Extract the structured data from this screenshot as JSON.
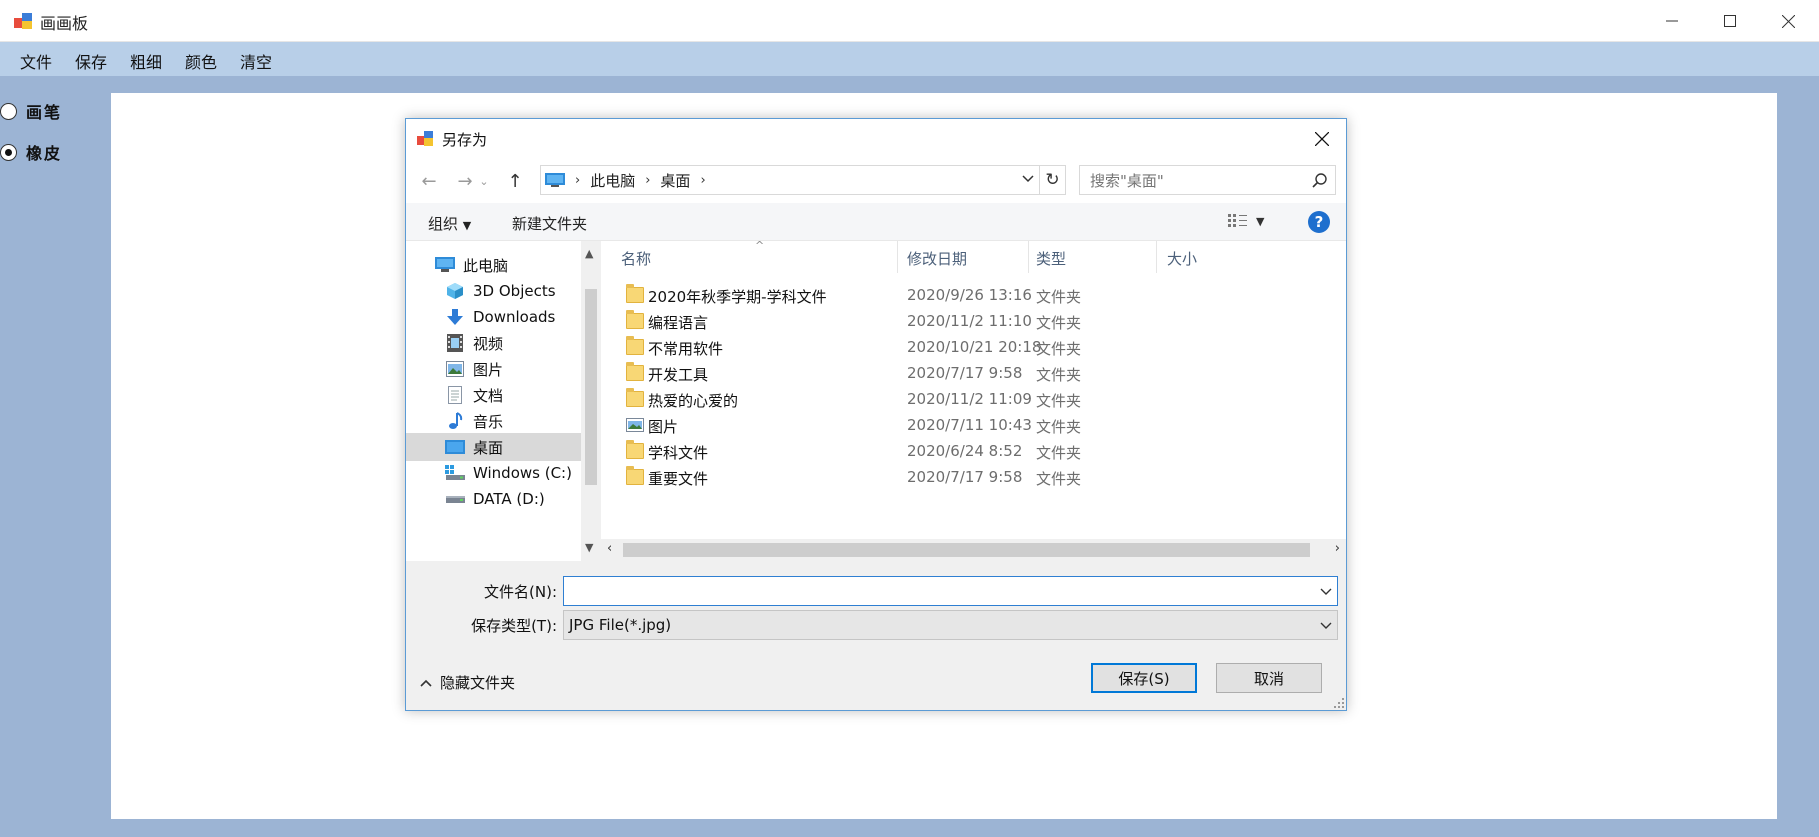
{
  "app": {
    "title": "画画板",
    "menu": [
      "文件",
      "保存",
      "粗细",
      "颜色",
      "清空"
    ],
    "tools": [
      {
        "label": "画笔",
        "checked": false
      },
      {
        "label": "橡皮",
        "checked": true
      }
    ]
  },
  "dialog": {
    "title": "另存为",
    "breadcrumb": [
      "此电脑",
      "桌面"
    ],
    "search_placeholder": "搜索\"桌面\"",
    "toolbar": {
      "organize": "组织",
      "new_folder": "新建文件夹",
      "help": "?"
    },
    "nav_items": [
      {
        "label": "此电脑",
        "icon": "computer-icon"
      },
      {
        "label": "3D Objects",
        "icon": "3d-objects-icon"
      },
      {
        "label": "Downloads",
        "icon": "download-icon"
      },
      {
        "label": "视频",
        "icon": "video-icon"
      },
      {
        "label": "图片",
        "icon": "pictures-icon"
      },
      {
        "label": "文档",
        "icon": "documents-icon"
      },
      {
        "label": "音乐",
        "icon": "music-icon"
      },
      {
        "label": "桌面",
        "icon": "desktop-icon"
      },
      {
        "label": "Windows (C:)",
        "icon": "drive-c-icon"
      },
      {
        "label": "DATA (D:)",
        "icon": "drive-d-icon"
      }
    ],
    "columns": [
      "名称",
      "修改日期",
      "类型",
      "大小"
    ],
    "files": [
      {
        "name": "2020年秋季学期-学科文件",
        "date": "2020/9/26 13:16",
        "type": "文件夹",
        "icon": "folder-icon"
      },
      {
        "name": "编程语言",
        "date": "2020/11/2 11:10",
        "type": "文件夹",
        "icon": "folder-icon"
      },
      {
        "name": "不常用软件",
        "date": "2020/10/21 20:18",
        "type": "文件夹",
        "icon": "folder-icon"
      },
      {
        "name": "开发工具",
        "date": "2020/7/17 9:58",
        "type": "文件夹",
        "icon": "folder-icon"
      },
      {
        "name": "热爱的心爱的",
        "date": "2020/11/2 11:09",
        "type": "文件夹",
        "icon": "folder-icon"
      },
      {
        "name": "图片",
        "date": "2020/7/11 10:43",
        "type": "文件夹",
        "icon": "pictures-folder-icon"
      },
      {
        "name": "学科文件",
        "date": "2020/6/24 8:52",
        "type": "文件夹",
        "icon": "folder-icon"
      },
      {
        "name": "重要文件",
        "date": "2020/7/17 9:58",
        "type": "文件夹",
        "icon": "folder-icon"
      }
    ],
    "filename_label": "文件名(N):",
    "filename_value": "",
    "filetype_label": "保存类型(T):",
    "filetype_value": "JPG File(*.jpg)",
    "hide_folders": "隐藏文件夹",
    "save_button": "保存(S)",
    "cancel_button": "取消"
  },
  "colors": {
    "accent": "#0078d7",
    "menubar": "#b8cfe8",
    "background": "#9cb4d4",
    "folder": "#f8d775"
  }
}
